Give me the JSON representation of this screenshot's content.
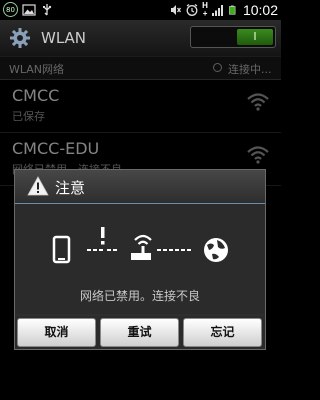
{
  "status_bar": {
    "badge": "80",
    "network_label": "H",
    "network_sub": "+",
    "time": "10:02"
  },
  "title_bar": {
    "title": "WLAN",
    "toggle_label": "I"
  },
  "section": {
    "title": "WLAN网络",
    "status": "连接中..."
  },
  "networks": [
    {
      "name": "CMCC",
      "status": "已保存"
    },
    {
      "name": "CMCC-EDU",
      "status": "网络已禁用。连接不良"
    }
  ],
  "dialog": {
    "title": "注意",
    "message": "网络已禁用。连接不良",
    "buttons": [
      "取消",
      "重试",
      "忘记"
    ]
  },
  "colors": {
    "accent_green": "#3a8a1e",
    "dialog_divider": "#6a8dac"
  }
}
